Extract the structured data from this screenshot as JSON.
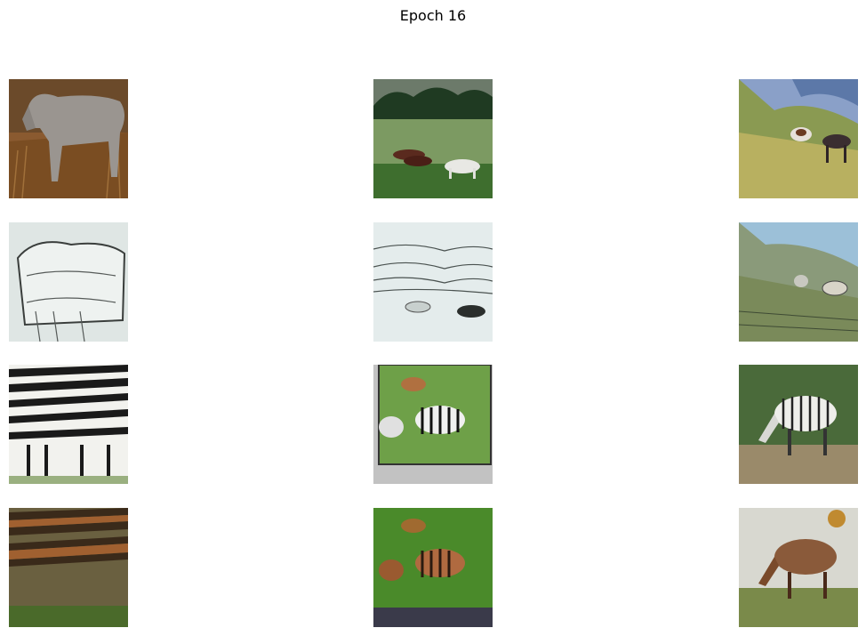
{
  "figure": {
    "title": "Epoch 16"
  },
  "rows": [
    {
      "name": "real-horse-row",
      "tiles": [
        {
          "name": "horse-photo-1",
          "subject": "horse"
        },
        {
          "name": "horse-photo-2",
          "subject": "horses-in-field"
        },
        {
          "name": "horse-photo-3",
          "subject": "horses-on-hillside"
        }
      ]
    },
    {
      "name": "generated-zebra-row",
      "tiles": [
        {
          "name": "generated-zebra-1",
          "subject": "stylized-horse"
        },
        {
          "name": "generated-zebra-2",
          "subject": "stylized-field"
        },
        {
          "name": "generated-zebra-3",
          "subject": "stylized-hillside"
        }
      ]
    },
    {
      "name": "real-zebra-row",
      "tiles": [
        {
          "name": "zebra-photo-1",
          "subject": "zebra-herd"
        },
        {
          "name": "zebra-photo-2",
          "subject": "zebras-and-antelope"
        },
        {
          "name": "zebra-photo-3",
          "subject": "grazing-zebra"
        }
      ]
    },
    {
      "name": "generated-horse-row",
      "tiles": [
        {
          "name": "generated-horse-1",
          "subject": "brown-striped-herd"
        },
        {
          "name": "generated-horse-2",
          "subject": "brown-striped-pair"
        },
        {
          "name": "generated-horse-3",
          "subject": "brown-grazing-animal"
        }
      ]
    }
  ]
}
